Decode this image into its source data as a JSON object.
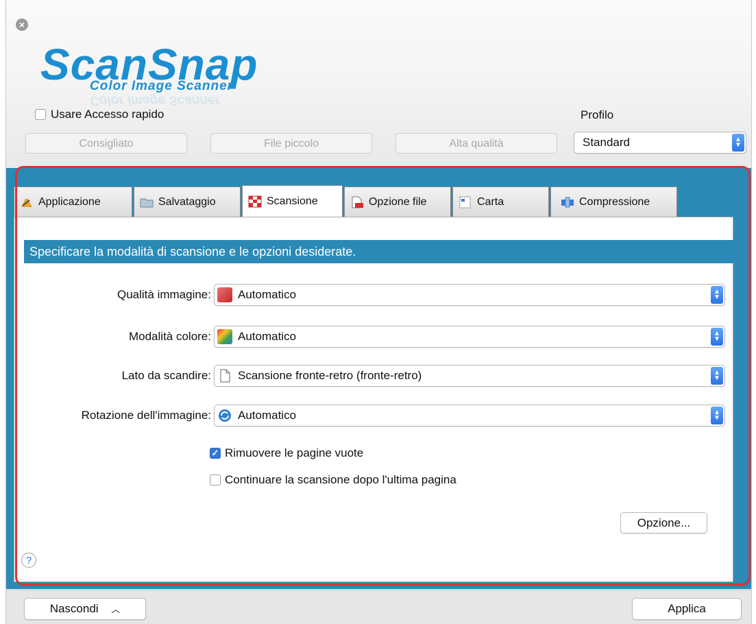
{
  "logo": {
    "main": "ScanSnap",
    "sub": "Color Image Scanner"
  },
  "quick_access": {
    "label": "Usare Accesso rapido",
    "checked": false
  },
  "presets": [
    "Consigliato",
    "File piccolo",
    "Alta qualità"
  ],
  "profile": {
    "label": "Profilo",
    "value": "Standard"
  },
  "tabs": [
    {
      "label": "Applicazione",
      "icon": "pen-icon"
    },
    {
      "label": "Salvataggio",
      "icon": "folder-icon"
    },
    {
      "label": "Scansione",
      "icon": "scan-checker-icon",
      "active": true
    },
    {
      "label": "Opzione file",
      "icon": "file-icon"
    },
    {
      "label": "Carta",
      "icon": "paper-icon"
    },
    {
      "label": "Compressione",
      "icon": "compression-icon"
    }
  ],
  "banner": "Specificare la modalità di scansione e le opzioni desiderate.",
  "fields": [
    {
      "label": "Qualità immagine:",
      "value": "Automatico",
      "icon": "quality-auto-icon"
    },
    {
      "label": "Modalità colore:",
      "value": "Automatico",
      "icon": "color-auto-icon"
    },
    {
      "label": "Lato da scandire:",
      "value": "Scansione fronte-retro (fronte-retro)",
      "icon": "duplex-page-icon"
    },
    {
      "label": "Rotazione dell'immagine:",
      "value": "Automatico",
      "icon": "rotate-icon"
    }
  ],
  "options": [
    {
      "label": "Rimuovere le pagine vuote",
      "checked": true
    },
    {
      "label": "Continuare la scansione dopo l'ultima pagina",
      "checked": false
    }
  ],
  "buttons": {
    "option": "Opzione...",
    "hide": "Nascondi",
    "apply": "Applica",
    "help": "?"
  },
  "colors": {
    "accent": "#2a8ab5",
    "logo": "#1c8fd0",
    "highlight": "#e03033"
  }
}
